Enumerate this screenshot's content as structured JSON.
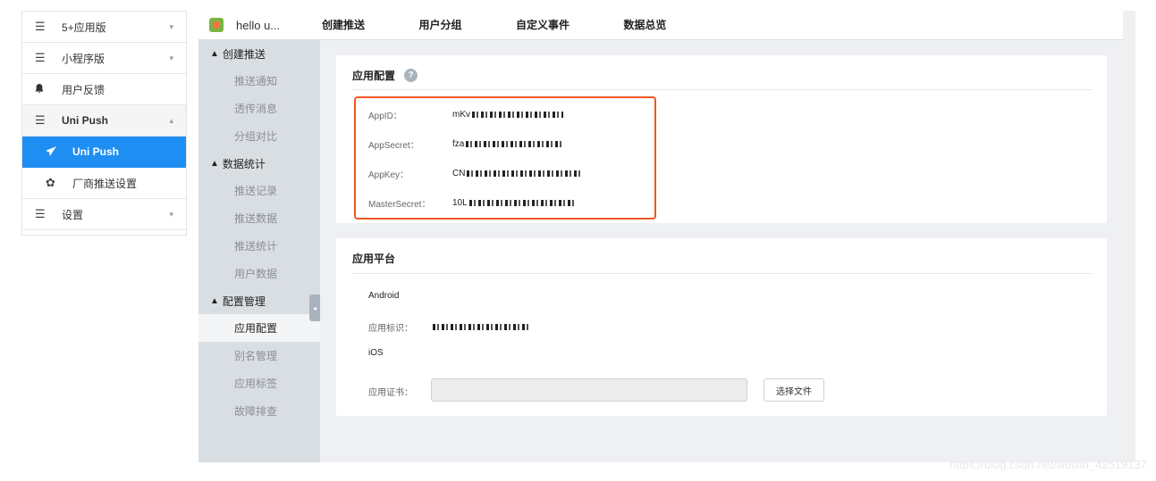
{
  "sidebar": {
    "items": [
      {
        "label": "5+应用版",
        "icon": "menu-icon",
        "caret": "▾"
      },
      {
        "label": "小程序版",
        "icon": "menu-icon",
        "caret": "▾"
      },
      {
        "label": "用户反馈",
        "icon": "bell-icon",
        "caret": ""
      },
      {
        "label": "Uni Push",
        "icon": "menu-icon",
        "caret": "▴"
      },
      {
        "label": "Uni Push",
        "icon": "send-icon",
        "caret": ""
      },
      {
        "label": "厂商推送设置",
        "icon": "gear-icon",
        "caret": ""
      },
      {
        "label": "设置",
        "icon": "menu-icon",
        "caret": "▾"
      }
    ]
  },
  "header": {
    "app_name": "hello u...",
    "tabs": [
      "创建推送",
      "用户分组",
      "自定义事件",
      "数据总览"
    ]
  },
  "menu": {
    "groups": [
      {
        "title": "创建推送",
        "items": [
          "推送通知",
          "透传消息",
          "分组对比"
        ]
      },
      {
        "title": "数据统计",
        "items": [
          "推送记录",
          "推送数据",
          "推送统计",
          "用户数据"
        ]
      },
      {
        "title": "配置管理",
        "items": [
          "应用配置",
          "别名管理",
          "应用标签",
          "故障排查"
        ]
      }
    ],
    "active_item": "应用配置"
  },
  "config": {
    "title": "应用配置",
    "help": "?",
    "fields": [
      {
        "label": "AppID：",
        "prefix": "mKv"
      },
      {
        "label": "AppSecret：",
        "prefix": "fza"
      },
      {
        "label": "AppKey：",
        "prefix": "CN"
      },
      {
        "label": "MasterSecret：",
        "prefix": "10L"
      }
    ]
  },
  "platform": {
    "title": "应用平台",
    "android_label": "Android",
    "package_label": "应用标识：",
    "ios_label": "iOS",
    "cert_label": "应用证书：",
    "choose_file": "选择文件"
  },
  "watermark": "https://blog.csdn.net/weixin_42519137",
  "colors": {
    "accent": "#1e8ef2",
    "highlight_border": "#f0561f"
  }
}
